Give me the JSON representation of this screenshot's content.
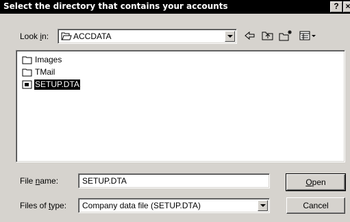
{
  "window": {
    "title": "Select the directory that contains your accounts",
    "help_label": "?",
    "close_label": "×"
  },
  "lookin": {
    "label_prefix": "Look ",
    "label_hotkey": "i",
    "label_suffix": "n:",
    "value": "ACCDATA"
  },
  "files": [
    {
      "name": "Images",
      "type": "folder",
      "selected": false
    },
    {
      "name": "TMail",
      "type": "folder",
      "selected": false
    },
    {
      "name": "SETUP.DTA",
      "type": "file",
      "selected": true
    }
  ],
  "filename": {
    "label_prefix": "File ",
    "label_hotkey": "n",
    "label_suffix": "ame:",
    "value": "SETUP.DTA"
  },
  "filetype": {
    "label_prefix": "Files of ",
    "label_hotkey": "t",
    "label_suffix": "ype:",
    "value": "Company data file (SETUP.DTA)"
  },
  "buttons": {
    "open_hotkey": "O",
    "open_rest": "pen",
    "cancel": "Cancel"
  },
  "toolbar": {
    "icons": [
      "back-arrow-icon",
      "up-one-level-icon",
      "new-folder-icon",
      "view-menu-icon"
    ]
  }
}
